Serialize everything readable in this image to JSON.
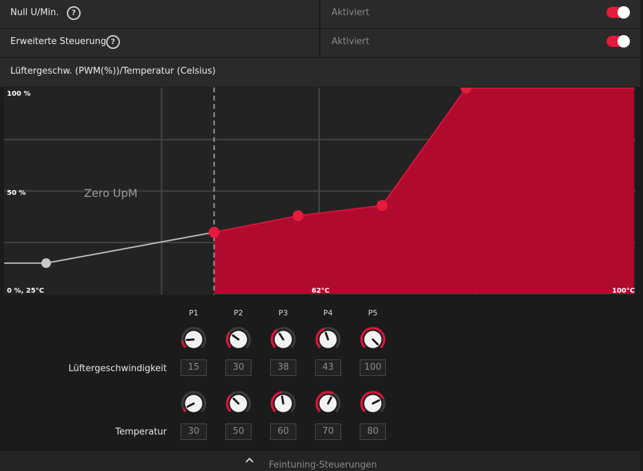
{
  "settings": {
    "zero_rpm": {
      "label": "Null U/Min.",
      "value": "Aktiviert"
    },
    "advanced_control": {
      "label": "Erweiterte Steuerung",
      "value": "Aktiviert"
    }
  },
  "chart_section_title": "Lüftergeschw. (PWM(%))/Temperatur (Celsius)",
  "chart_data": {
    "type": "area",
    "title": "Lüftergeschw. (PWM(%))/Temperatur (Celsius)",
    "y_tick_labels": {
      "top": "100 %",
      "mid": "50 %",
      "origin": "0 %, 25°C"
    },
    "x_tick_labels": {
      "mid": "62°C",
      "right": "100°C"
    },
    "zero_rpm_label": "Zero UpM",
    "xlim": [
      25,
      100
    ],
    "ylim": [
      0,
      100
    ],
    "grid": true,
    "colors": {
      "fill": "#b00a2e",
      "line": "#d8143a",
      "point": "#e31b3c",
      "zero_line": "#bfbfbf",
      "background": "#232323",
      "grid": "#454545"
    },
    "zero_rpm_threshold_c": 50,
    "zero_rpm_segment": [
      {
        "x": 25,
        "y": 15
      },
      {
        "x": 30,
        "y": 15
      },
      {
        "x": 50,
        "y": 30
      }
    ],
    "points": [
      {
        "name": "P1",
        "x": 30,
        "y": 15
      },
      {
        "name": "P2",
        "x": 50,
        "y": 30
      },
      {
        "name": "P3",
        "x": 60,
        "y": 38
      },
      {
        "name": "P4",
        "x": 70,
        "y": 43
      },
      {
        "name": "P5",
        "x": 80,
        "y": 100
      }
    ]
  },
  "controls": {
    "speed_label": "Lüftergeschwindigkeit",
    "temp_label": "Temperatur",
    "columns": [
      {
        "name": "P1",
        "speed": "15",
        "temp": "30"
      },
      {
        "name": "P2",
        "speed": "30",
        "temp": "50"
      },
      {
        "name": "P3",
        "speed": "38",
        "temp": "60"
      },
      {
        "name": "P4",
        "speed": "43",
        "temp": "70"
      },
      {
        "name": "P5",
        "speed": "100",
        "temp": "80"
      }
    ]
  },
  "footer": {
    "label": "Feintuning-Steuerungen",
    "icon": "chevron-up-icon"
  }
}
